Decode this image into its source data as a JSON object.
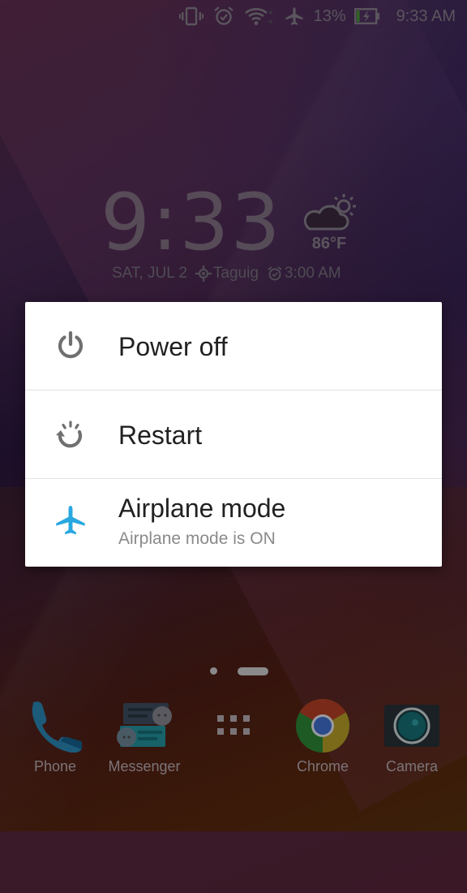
{
  "status_bar": {
    "icons": [
      "vibrate-icon",
      "alarm-icon",
      "wifi-icon",
      "airplane-icon",
      "battery-charging-icon"
    ],
    "battery_percent": "13%",
    "time": "9:33 AM"
  },
  "clock_widget": {
    "hours": "9",
    "separator": ":",
    "minutes": "33",
    "weather_icon": "partly-cloudy-icon",
    "temperature": "86°F",
    "date": "SAT, JUL 2",
    "location": "Taguig",
    "alarm": "3:00 AM"
  },
  "power_menu": {
    "items": [
      {
        "icon": "power-icon",
        "label": "Power off"
      },
      {
        "icon": "restart-icon",
        "label": "Restart"
      },
      {
        "icon": "airplane-icon",
        "label": "Airplane mode",
        "sublabel": "Airplane mode is ON"
      }
    ],
    "accent_color": "#29a8e0",
    "icon_color": "#707070"
  },
  "home_pages": {
    "count": 2,
    "current": 2
  },
  "dock": {
    "apps": [
      {
        "icon": "phone-icon",
        "label": "Phone"
      },
      {
        "icon": "messenger-icon",
        "label": "Messenger"
      },
      {
        "icon": "app-drawer-icon",
        "label": ""
      },
      {
        "icon": "chrome-icon",
        "label": "Chrome"
      },
      {
        "icon": "camera-icon",
        "label": "Camera"
      }
    ]
  }
}
